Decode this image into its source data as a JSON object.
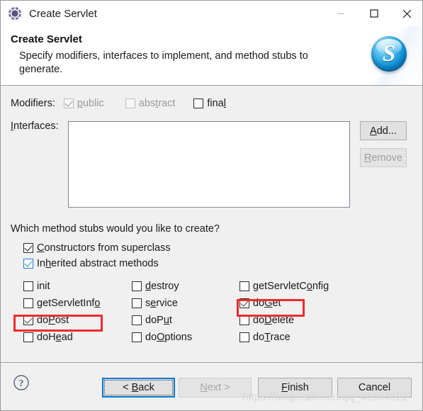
{
  "window": {
    "title": "Create Servlet",
    "icon": "servlet-gear-icon",
    "controls": {
      "minimize": "minimize-icon",
      "maximize": "maximize-icon",
      "close": "close-icon"
    }
  },
  "header": {
    "title": "Create Servlet",
    "description": "Specify modifiers, interfaces to implement, and method stubs to generate.",
    "logo_letter": "S"
  },
  "modifiers": {
    "label": "Modifiers:",
    "options": [
      {
        "label": "public",
        "pre": "",
        "mnemonic": "p",
        "post": "ublic",
        "checked": true,
        "enabled": false
      },
      {
        "label": "abstract",
        "pre": "abs",
        "mnemonic": "t",
        "post": "ract",
        "checked": false,
        "enabled": false
      },
      {
        "label": "final",
        "pre": "fina",
        "mnemonic": "l",
        "post": "",
        "checked": false,
        "enabled": true
      }
    ]
  },
  "interfaces": {
    "label": "Interfaces:",
    "items": [],
    "add_button": {
      "pre": "",
      "mnemonic": "A",
      "post": "dd...",
      "label": "Add...",
      "enabled": true
    },
    "remove_button": {
      "pre": "",
      "mnemonic": "R",
      "post": "emove",
      "label": "Remove",
      "enabled": false
    }
  },
  "method_stubs": {
    "question": "Which method stubs would you like to create?",
    "top_options": [
      {
        "pre": "",
        "mnemonic": "C",
        "post": "onstructors from superclass",
        "label": "Constructors from superclass",
        "checked": true,
        "check_style": "dark"
      },
      {
        "pre": "In",
        "mnemonic": "h",
        "post": "erited abstract methods",
        "label": "Inherited abstract methods",
        "checked": true,
        "check_style": "blue"
      }
    ],
    "grid": [
      [
        {
          "pre": "init",
          "mnemonic": "",
          "post": "",
          "label": "init",
          "checked": false,
          "highlighted": false
        },
        {
          "pre": "",
          "mnemonic": "d",
          "post": "estroy",
          "label": "destroy",
          "checked": false,
          "highlighted": false
        },
        {
          "pre": "getServletC",
          "mnemonic": "o",
          "post": "nfig",
          "label": "getServletConfig",
          "checked": false,
          "highlighted": false
        }
      ],
      [
        {
          "pre": "getServletInf",
          "mnemonic": "o",
          "post": "",
          "label": "getServletInfo",
          "checked": false,
          "highlighted": false
        },
        {
          "pre": "s",
          "mnemonic": "e",
          "post": "rvice",
          "label": "service",
          "checked": false,
          "highlighted": false
        },
        {
          "pre": "do",
          "mnemonic": "G",
          "post": "et",
          "label": "doGet",
          "checked": true,
          "highlighted": true
        }
      ],
      [
        {
          "pre": "do",
          "mnemonic": "P",
          "post": "ost",
          "label": "doPost",
          "checked": true,
          "highlighted": true
        },
        {
          "pre": "doP",
          "mnemonic": "u",
          "post": "t",
          "label": "doPut",
          "checked": false,
          "highlighted": false
        },
        {
          "pre": "do",
          "mnemonic": "D",
          "post": "elete",
          "label": "doDelete",
          "checked": false,
          "highlighted": false
        }
      ],
      [
        {
          "pre": "doH",
          "mnemonic": "e",
          "post": "ad",
          "label": "doHead",
          "checked": false,
          "highlighted": false
        },
        {
          "pre": "do",
          "mnemonic": "O",
          "post": "ptions",
          "label": "doOptions",
          "checked": false,
          "highlighted": false
        },
        {
          "pre": "do",
          "mnemonic": "T",
          "post": "race",
          "label": "doTrace",
          "checked": false,
          "highlighted": false
        }
      ]
    ]
  },
  "footer": {
    "help_icon": "help-question-icon",
    "buttons": [
      {
        "name": "back",
        "pre": "< ",
        "mnemonic": "B",
        "post": "ack",
        "label": "< Back",
        "enabled": true,
        "focused": true
      },
      {
        "name": "next",
        "pre": "",
        "mnemonic": "N",
        "post": "ext >",
        "label": "Next >",
        "enabled": false,
        "focused": false
      },
      {
        "name": "finish",
        "pre": "",
        "mnemonic": "F",
        "post": "inish",
        "label": "Finish",
        "enabled": true,
        "focused": false
      },
      {
        "name": "cancel",
        "pre": "Cancel",
        "mnemonic": "",
        "post": "",
        "label": "Cancel",
        "enabled": true,
        "focused": false
      }
    ]
  },
  "watermark": "https://blog.csdn.net/qq_41684621",
  "colors": {
    "dialog_bg": "#f0f0f0",
    "header_bg": "#ffffff",
    "accent_blue": "#0078d7",
    "annotation_red": "#f02b2b",
    "logo_blue": "#0f8fd4"
  }
}
